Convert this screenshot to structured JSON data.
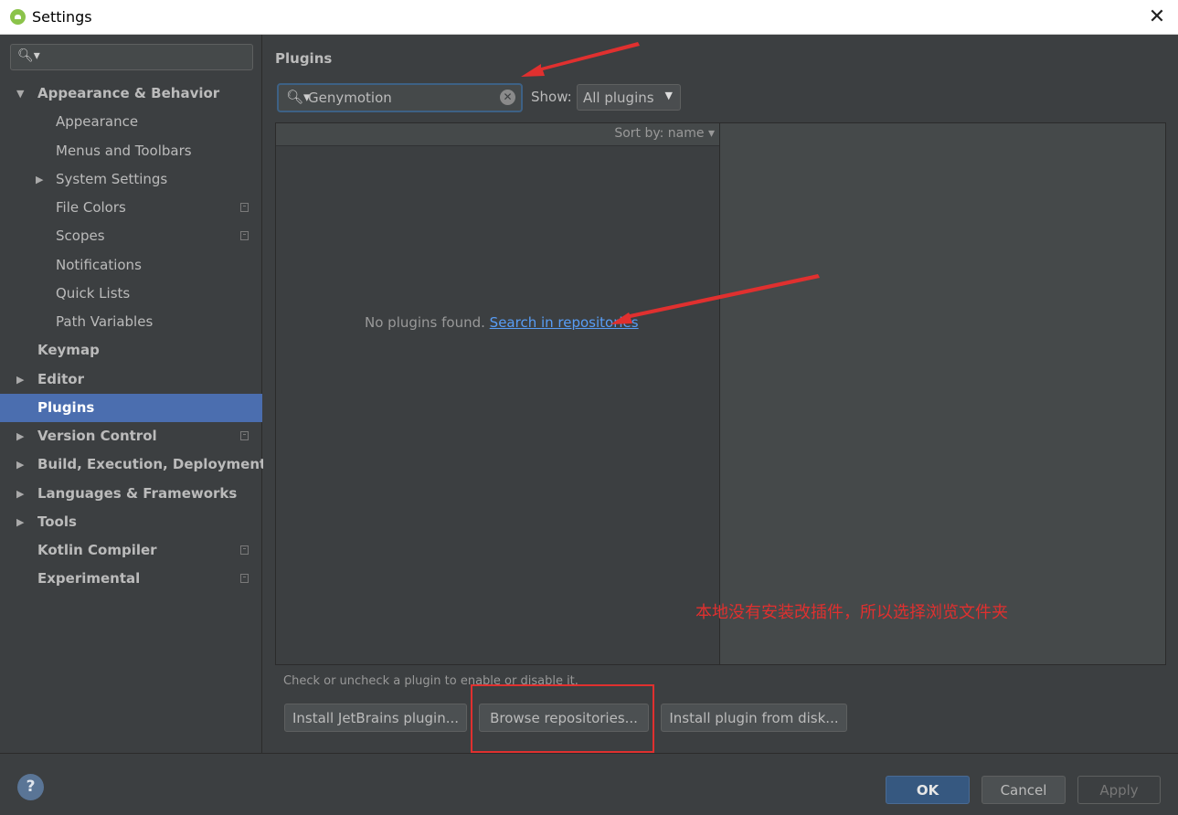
{
  "window": {
    "title": "Settings",
    "close_glyph": "✕"
  },
  "sidebar": {
    "search_icon": "search-icon",
    "items": [
      {
        "label": "Appearance & Behavior",
        "bold": true,
        "arrow": "▼",
        "indent": 0
      },
      {
        "label": "Appearance",
        "bold": false,
        "arrow": "",
        "indent": 1
      },
      {
        "label": "Menus and Toolbars",
        "bold": false,
        "arrow": "",
        "indent": 1
      },
      {
        "label": "System Settings",
        "bold": false,
        "arrow": "▶",
        "indent": 1
      },
      {
        "label": "File Colors",
        "bold": false,
        "arrow": "",
        "indent": 1,
        "project": true
      },
      {
        "label": "Scopes",
        "bold": false,
        "arrow": "",
        "indent": 1,
        "project": true
      },
      {
        "label": "Notifications",
        "bold": false,
        "arrow": "",
        "indent": 1
      },
      {
        "label": "Quick Lists",
        "bold": false,
        "arrow": "",
        "indent": 1
      },
      {
        "label": "Path Variables",
        "bold": false,
        "arrow": "",
        "indent": 1
      },
      {
        "label": "Keymap",
        "bold": true,
        "arrow": "",
        "indent": 0
      },
      {
        "label": "Editor",
        "bold": true,
        "arrow": "▶",
        "indent": 0
      },
      {
        "label": "Plugins",
        "bold": true,
        "arrow": "",
        "indent": 0,
        "selected": true
      },
      {
        "label": "Version Control",
        "bold": true,
        "arrow": "▶",
        "indent": 0,
        "project": true
      },
      {
        "label": "Build, Execution, Deployment",
        "bold": true,
        "arrow": "▶",
        "indent": 0
      },
      {
        "label": "Languages & Frameworks",
        "bold": true,
        "arrow": "▶",
        "indent": 0
      },
      {
        "label": "Tools",
        "bold": true,
        "arrow": "▶",
        "indent": 0
      },
      {
        "label": "Kotlin Compiler",
        "bold": true,
        "arrow": "",
        "indent": 0,
        "project": true
      },
      {
        "label": "Experimental",
        "bold": true,
        "arrow": "",
        "indent": 0,
        "project": true
      }
    ]
  },
  "plugins": {
    "heading": "Plugins",
    "search_value": "Genymotion",
    "show_label": "Show:",
    "show_value": "All plugins",
    "sort_label": "Sort by: name ▾",
    "empty_text": "No plugins found. ",
    "search_repo_link": "Search in repositories",
    "hint": "Check or uncheck a plugin to enable or disable it.",
    "buttons": {
      "install_jetbrains": "Install JetBrains plugin...",
      "browse_repos": "Browse repositories...",
      "install_disk": "Install plugin from disk..."
    }
  },
  "annotation": {
    "text": "本地没有安装改插件，所以选择浏览文件夹",
    "color": "#e0302f"
  },
  "footer": {
    "help": "?",
    "ok": "OK",
    "cancel": "Cancel",
    "apply": "Apply"
  },
  "colors": {
    "accent": "#4b6eaf",
    "link": "#589df6",
    "ok_button": "#365880"
  }
}
